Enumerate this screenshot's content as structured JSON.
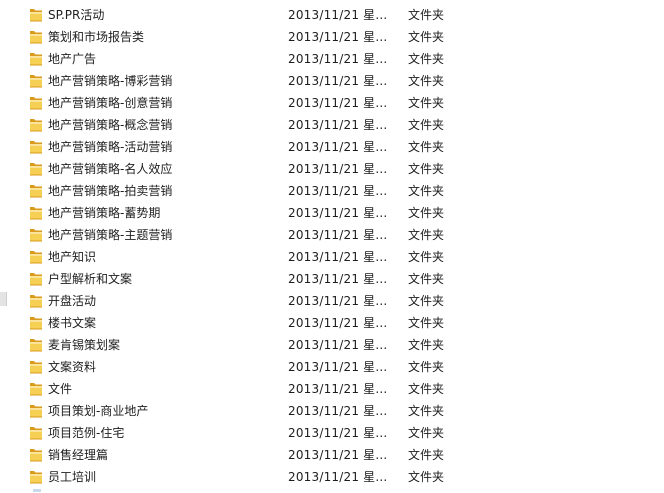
{
  "files": [
    {
      "name": "SP.PR活动",
      "date": "2013/11/21 星...",
      "type": "文件夹"
    },
    {
      "name": "策划和市场报告类",
      "date": "2013/11/21 星...",
      "type": "文件夹"
    },
    {
      "name": "地产广告",
      "date": "2013/11/21 星...",
      "type": "文件夹"
    },
    {
      "name": "地产营销策略-博彩营销",
      "date": "2013/11/21 星...",
      "type": "文件夹"
    },
    {
      "name": "地产营销策略-创意营销",
      "date": "2013/11/21 星...",
      "type": "文件夹"
    },
    {
      "name": "地产营销策略-概念营销",
      "date": "2013/11/21 星...",
      "type": "文件夹"
    },
    {
      "name": "地产营销策略-活动营销",
      "date": "2013/11/21 星...",
      "type": "文件夹"
    },
    {
      "name": "地产营销策略-名人效应",
      "date": "2013/11/21 星...",
      "type": "文件夹"
    },
    {
      "name": "地产营销策略-拍卖营销",
      "date": "2013/11/21 星...",
      "type": "文件夹"
    },
    {
      "name": "地产营销策略-蓄势期",
      "date": "2013/11/21 星...",
      "type": "文件夹"
    },
    {
      "name": "地产营销策略-主题营销",
      "date": "2013/11/21 星...",
      "type": "文件夹"
    },
    {
      "name": "地产知识",
      "date": "2013/11/21 星...",
      "type": "文件夹"
    },
    {
      "name": "户型解析和文案",
      "date": "2013/11/21 星...",
      "type": "文件夹"
    },
    {
      "name": "开盘活动",
      "date": "2013/11/21 星...",
      "type": "文件夹"
    },
    {
      "name": "楼书文案",
      "date": "2013/11/21 星...",
      "type": "文件夹"
    },
    {
      "name": "麦肯锡策划案",
      "date": "2013/11/21 星...",
      "type": "文件夹"
    },
    {
      "name": "文案资料",
      "date": "2013/11/21 星...",
      "type": "文件夹"
    },
    {
      "name": "文件",
      "date": "2013/11/21 星...",
      "type": "文件夹"
    },
    {
      "name": "项目策划-商业地产",
      "date": "2013/11/21 星...",
      "type": "文件夹"
    },
    {
      "name": "项目范例-住宅",
      "date": "2013/11/21 星...",
      "type": "文件夹"
    },
    {
      "name": "销售经理篇",
      "date": "2013/11/21 星...",
      "type": "文件夹"
    },
    {
      "name": "员工培训",
      "date": "2013/11/21 星...",
      "type": "文件夹"
    }
  ],
  "icon": "folder-icon",
  "colors": {
    "folder_back": "#d99b1c",
    "folder_front": "#f6cf55",
    "folder_light": "#fbe49a",
    "text": "#1e1e1e"
  }
}
